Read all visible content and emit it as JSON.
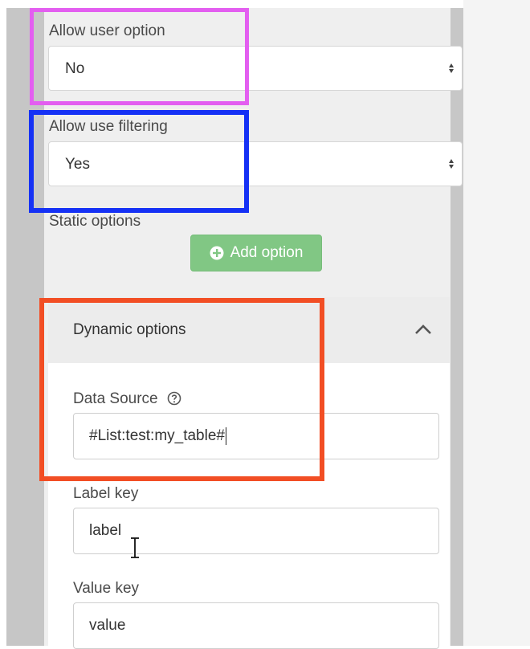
{
  "form": {
    "allow_user_option": {
      "label": "Allow user option",
      "value": "No"
    },
    "allow_use_filtering": {
      "label": "Allow use filtering",
      "value": "Yes"
    },
    "static_options": {
      "label": "Static options",
      "add_button_label": "Add option"
    },
    "dynamic_options": {
      "title": "Dynamic options",
      "expanded": true,
      "data_source": {
        "label": "Data Source",
        "value": "#List:test:my_table#"
      },
      "label_key": {
        "label": "Label key",
        "value": "label"
      },
      "value_key": {
        "label": "Value key",
        "value": "value"
      }
    }
  },
  "icons": {
    "select_arrows": "sort-arrows-icon",
    "add": "plus-circle-icon",
    "collapse": "chevron-up-icon",
    "help": "help-circle-icon",
    "cursor": "text-cursor-icon"
  },
  "colors": {
    "add_button": "#81c784",
    "highlight_pink": "#e35ef0",
    "highlight_blue": "#1531f5",
    "highlight_orange": "#f24e24"
  }
}
